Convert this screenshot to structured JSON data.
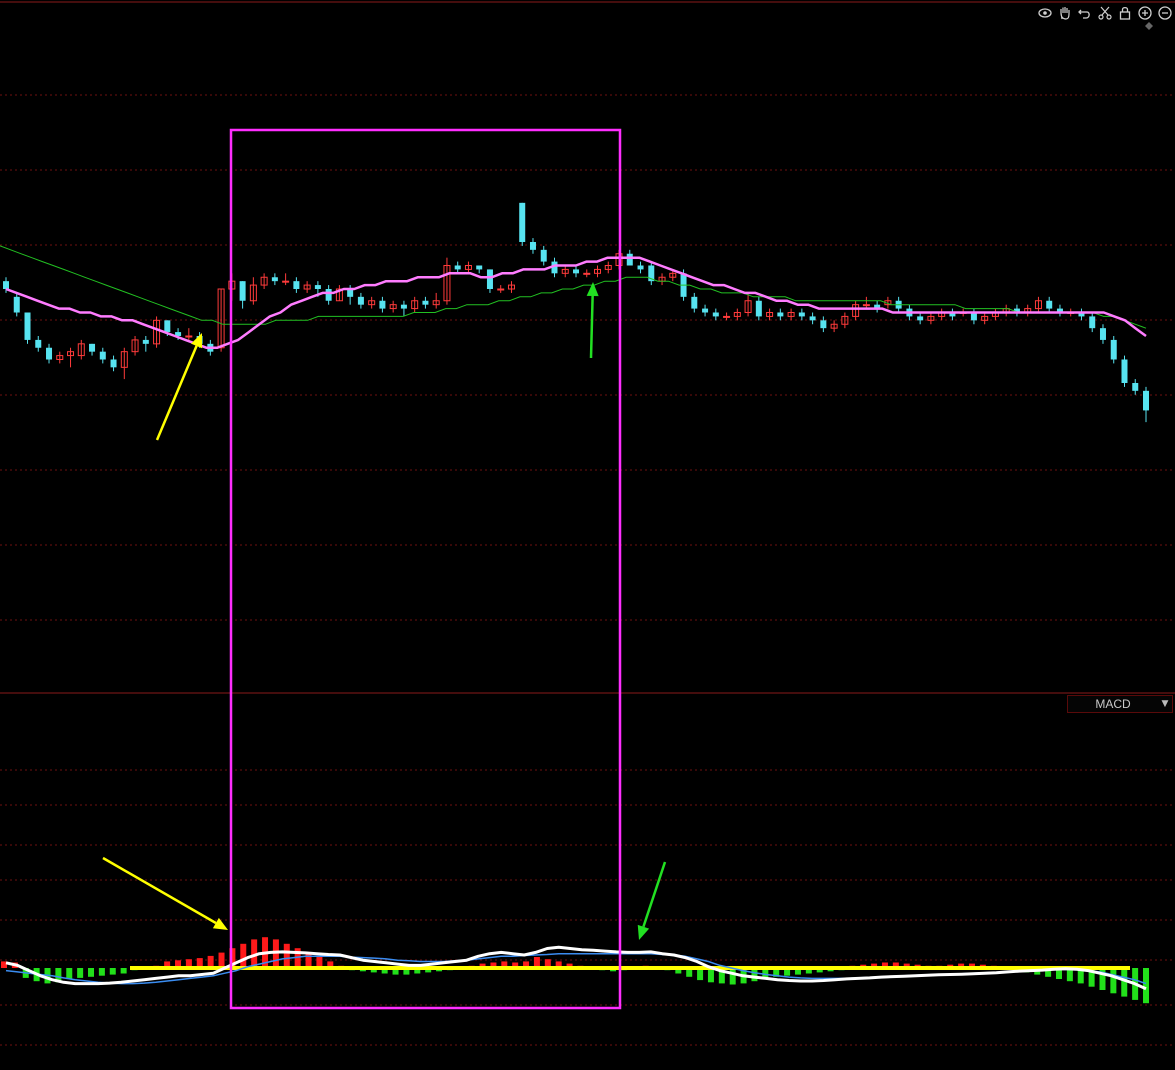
{
  "toolbar": {
    "tools": [
      {
        "name": "eye-icon",
        "title": ""
      },
      {
        "name": "hand-icon",
        "title": ""
      },
      {
        "name": "undo-icon",
        "title": ""
      },
      {
        "name": "scissors-icon",
        "title": ""
      },
      {
        "name": "lock-icon",
        "title": ""
      },
      {
        "name": "zoom-in-icon",
        "title": ""
      },
      {
        "name": "zoom-out-icon",
        "title": ""
      }
    ],
    "icon_color": "#cfcfcf"
  },
  "indicator": {
    "label": "MACD"
  },
  "colors": {
    "background": "#000000",
    "grid": "#6e0f0f",
    "divider": "#8a1a1a",
    "up_candle": "#ff3b3b",
    "down_candle": "#57e3f0",
    "ma_fast": "#ff7cff",
    "ma_slow": "#22c022",
    "macd_dif": "#ffffff",
    "macd_dea": "#3a8cf0",
    "macd_pos": "#ff1a1a",
    "macd_neg": "#22e01a",
    "zero_line": "#ffff00",
    "highlight_box": "#ff2eff",
    "arrow_yellow": "#ffff00",
    "arrow_green": "#22e022"
  },
  "chart_data": [
    {
      "type": "candlestick",
      "panel": "price",
      "count": 98,
      "candles": [
        [
          0.78,
          0.76,
          0.79,
          0.75
        ],
        [
          0.74,
          0.7,
          0.75,
          0.69
        ],
        [
          0.7,
          0.63,
          0.7,
          0.62
        ],
        [
          0.63,
          0.61,
          0.64,
          0.6
        ],
        [
          0.61,
          0.58,
          0.62,
          0.57
        ],
        [
          0.58,
          0.59,
          0.6,
          0.57
        ],
        [
          0.59,
          0.6,
          0.61,
          0.56
        ],
        [
          0.59,
          0.62,
          0.63,
          0.58
        ],
        [
          0.62,
          0.6,
          0.62,
          0.59
        ],
        [
          0.6,
          0.58,
          0.61,
          0.57
        ],
        [
          0.58,
          0.56,
          0.59,
          0.55
        ],
        [
          0.56,
          0.6,
          0.61,
          0.53
        ],
        [
          0.6,
          0.63,
          0.64,
          0.59
        ],
        [
          0.63,
          0.62,
          0.64,
          0.6
        ],
        [
          0.62,
          0.68,
          0.69,
          0.61
        ],
        [
          0.68,
          0.65,
          0.68,
          0.64
        ],
        [
          0.65,
          0.64,
          0.66,
          0.63
        ],
        [
          0.64,
          0.64,
          0.66,
          0.63
        ],
        [
          0.64,
          0.62,
          0.65,
          0.61
        ],
        [
          0.62,
          0.6,
          0.63,
          0.59
        ],
        [
          0.61,
          0.76,
          0.76,
          0.6
        ],
        [
          0.76,
          0.78,
          0.8,
          0.73
        ],
        [
          0.78,
          0.73,
          0.78,
          0.71
        ],
        [
          0.73,
          0.77,
          0.79,
          0.72
        ],
        [
          0.77,
          0.79,
          0.8,
          0.76
        ],
        [
          0.79,
          0.78,
          0.8,
          0.77
        ],
        [
          0.78,
          0.78,
          0.8,
          0.77
        ],
        [
          0.78,
          0.76,
          0.79,
          0.75
        ],
        [
          0.76,
          0.77,
          0.78,
          0.75
        ],
        [
          0.77,
          0.76,
          0.78,
          0.74
        ],
        [
          0.76,
          0.73,
          0.77,
          0.72
        ],
        [
          0.73,
          0.76,
          0.77,
          0.73
        ],
        [
          0.76,
          0.74,
          0.77,
          0.72
        ],
        [
          0.74,
          0.72,
          0.75,
          0.71
        ],
        [
          0.72,
          0.73,
          0.74,
          0.71
        ],
        [
          0.73,
          0.71,
          0.74,
          0.7
        ],
        [
          0.71,
          0.72,
          0.73,
          0.7
        ],
        [
          0.72,
          0.71,
          0.73,
          0.69
        ],
        [
          0.71,
          0.73,
          0.74,
          0.7
        ],
        [
          0.73,
          0.72,
          0.74,
          0.71
        ],
        [
          0.72,
          0.73,
          0.75,
          0.71
        ],
        [
          0.73,
          0.82,
          0.84,
          0.72
        ],
        [
          0.82,
          0.81,
          0.83,
          0.8
        ],
        [
          0.81,
          0.82,
          0.83,
          0.8
        ],
        [
          0.82,
          0.81,
          0.82,
          0.8
        ],
        [
          0.81,
          0.76,
          0.81,
          0.75
        ],
        [
          0.76,
          0.76,
          0.77,
          0.75
        ],
        [
          0.76,
          0.77,
          0.78,
          0.75
        ],
        [
          0.98,
          0.88,
          0.98,
          0.87
        ],
        [
          0.88,
          0.86,
          0.89,
          0.85
        ],
        [
          0.86,
          0.83,
          0.87,
          0.82
        ],
        [
          0.83,
          0.8,
          0.84,
          0.79
        ],
        [
          0.8,
          0.81,
          0.82,
          0.79
        ],
        [
          0.81,
          0.8,
          0.82,
          0.79
        ],
        [
          0.8,
          0.8,
          0.81,
          0.79
        ],
        [
          0.8,
          0.81,
          0.82,
          0.79
        ],
        [
          0.81,
          0.82,
          0.83,
          0.8
        ],
        [
          0.82,
          0.85,
          0.86,
          0.81
        ],
        [
          0.85,
          0.82,
          0.86,
          0.82
        ],
        [
          0.82,
          0.81,
          0.83,
          0.8
        ],
        [
          0.82,
          0.78,
          0.83,
          0.77
        ],
        [
          0.78,
          0.79,
          0.8,
          0.77
        ],
        [
          0.79,
          0.8,
          0.81,
          0.78
        ],
        [
          0.8,
          0.74,
          0.81,
          0.73
        ],
        [
          0.74,
          0.71,
          0.75,
          0.7
        ],
        [
          0.71,
          0.7,
          0.72,
          0.69
        ],
        [
          0.7,
          0.69,
          0.71,
          0.68
        ],
        [
          0.69,
          0.69,
          0.7,
          0.68
        ],
        [
          0.69,
          0.7,
          0.71,
          0.68
        ],
        [
          0.7,
          0.73,
          0.75,
          0.69
        ],
        [
          0.73,
          0.69,
          0.74,
          0.68
        ],
        [
          0.69,
          0.7,
          0.71,
          0.68
        ],
        [
          0.7,
          0.69,
          0.71,
          0.68
        ],
        [
          0.69,
          0.7,
          0.71,
          0.68
        ],
        [
          0.7,
          0.69,
          0.71,
          0.68
        ],
        [
          0.69,
          0.68,
          0.7,
          0.67
        ],
        [
          0.68,
          0.66,
          0.69,
          0.65
        ],
        [
          0.66,
          0.67,
          0.68,
          0.65
        ],
        [
          0.67,
          0.69,
          0.7,
          0.66
        ],
        [
          0.69,
          0.72,
          0.73,
          0.68
        ],
        [
          0.72,
          0.72,
          0.74,
          0.71
        ],
        [
          0.72,
          0.71,
          0.73,
          0.7
        ],
        [
          0.72,
          0.73,
          0.74,
          0.71
        ],
        [
          0.73,
          0.71,
          0.74,
          0.7
        ],
        [
          0.71,
          0.69,
          0.72,
          0.68
        ],
        [
          0.69,
          0.68,
          0.7,
          0.67
        ],
        [
          0.68,
          0.69,
          0.7,
          0.67
        ],
        [
          0.69,
          0.7,
          0.71,
          0.68
        ],
        [
          0.7,
          0.69,
          0.71,
          0.68
        ],
        [
          0.7,
          0.7,
          0.71,
          0.69
        ],
        [
          0.7,
          0.68,
          0.71,
          0.67
        ],
        [
          0.68,
          0.69,
          0.7,
          0.67
        ],
        [
          0.69,
          0.7,
          0.71,
          0.68
        ],
        [
          0.7,
          0.71,
          0.72,
          0.69
        ],
        [
          0.71,
          0.7,
          0.72,
          0.69
        ],
        [
          0.7,
          0.71,
          0.72,
          0.69
        ],
        [
          0.71,
          0.73,
          0.74,
          0.7
        ],
        [
          0.73,
          0.71,
          0.74,
          0.7
        ]
      ],
      "tail_candles": [
        [
          0.71,
          0.7,
          0.72,
          0.69
        ],
        [
          0.7,
          0.7,
          0.71,
          0.69
        ],
        [
          0.7,
          0.69,
          0.71,
          0.68
        ],
        [
          0.69,
          0.66,
          0.7,
          0.65
        ],
        [
          0.66,
          0.63,
          0.67,
          0.62
        ],
        [
          0.63,
          0.58,
          0.64,
          0.57
        ],
        [
          0.58,
          0.52,
          0.59,
          0.51
        ],
        [
          0.52,
          0.5,
          0.53,
          0.49
        ],
        [
          0.5,
          0.45,
          0.51,
          0.42
        ]
      ],
      "ma_fast": [
        0.76,
        0.75,
        0.74,
        0.73,
        0.72,
        0.71,
        0.71,
        0.7,
        0.7,
        0.69,
        0.69,
        0.68,
        0.68,
        0.67,
        0.66,
        0.65,
        0.64,
        0.63,
        0.62,
        0.61,
        0.61,
        0.62,
        0.63,
        0.65,
        0.67,
        0.69,
        0.7,
        0.72,
        0.73,
        0.74,
        0.75,
        0.75,
        0.76,
        0.76,
        0.77,
        0.77,
        0.78,
        0.78,
        0.78,
        0.79,
        0.79,
        0.79,
        0.8,
        0.8,
        0.8,
        0.79,
        0.79,
        0.8,
        0.8,
        0.81,
        0.81,
        0.81,
        0.82,
        0.82,
        0.82,
        0.83,
        0.83,
        0.84,
        0.84,
        0.84,
        0.84,
        0.83,
        0.82,
        0.81,
        0.8,
        0.79,
        0.78,
        0.77,
        0.77,
        0.76,
        0.75,
        0.75,
        0.74,
        0.73,
        0.73,
        0.72,
        0.72,
        0.71,
        0.71,
        0.71,
        0.71,
        0.71,
        0.71,
        0.71,
        0.7,
        0.7,
        0.7,
        0.7,
        0.7,
        0.7,
        0.7,
        0.7,
        0.7,
        0.7,
        0.7,
        0.7,
        0.7,
        0.7,
        0.7,
        0.7,
        0.7,
        0.7,
        0.7,
        0.7,
        0.7,
        0.69,
        0.68,
        0.66,
        0.64
      ],
      "ma_slow": [
        0.87,
        0.86,
        0.85,
        0.84,
        0.83,
        0.82,
        0.81,
        0.8,
        0.79,
        0.78,
        0.77,
        0.76,
        0.75,
        0.74,
        0.73,
        0.72,
        0.71,
        0.7,
        0.69,
        0.68,
        0.68,
        0.67,
        0.67,
        0.67,
        0.67,
        0.67,
        0.68,
        0.68,
        0.68,
        0.68,
        0.69,
        0.69,
        0.69,
        0.69,
        0.69,
        0.69,
        0.69,
        0.69,
        0.69,
        0.7,
        0.7,
        0.7,
        0.71,
        0.71,
        0.72,
        0.72,
        0.72,
        0.73,
        0.73,
        0.74,
        0.74,
        0.75,
        0.75,
        0.76,
        0.76,
        0.77,
        0.77,
        0.78,
        0.78,
        0.79,
        0.79,
        0.79,
        0.78,
        0.78,
        0.77,
        0.77,
        0.76,
        0.76,
        0.75,
        0.75,
        0.75,
        0.74,
        0.74,
        0.74,
        0.74,
        0.73,
        0.73,
        0.73,
        0.73,
        0.73,
        0.73,
        0.73,
        0.73,
        0.73,
        0.72,
        0.72,
        0.72,
        0.72,
        0.72,
        0.72,
        0.72,
        0.71,
        0.71,
        0.71,
        0.71,
        0.71,
        0.7,
        0.7,
        0.7,
        0.7,
        0.7,
        0.7,
        0.7,
        0.7,
        0.69,
        0.69,
        0.68,
        0.67,
        0.66
      ],
      "grid": true,
      "title": "",
      "xlabel": "",
      "ylabel": ""
    },
    {
      "type": "bar",
      "panel": "macd",
      "indicator": "MACD",
      "hist": [
        0.3,
        0.25,
        -0.45,
        -0.6,
        -0.7,
        -0.65,
        -0.5,
        -0.45,
        -0.4,
        -0.35,
        -0.3,
        -0.25,
        -0.1,
        0.0,
        0.1,
        0.3,
        0.35,
        0.4,
        0.45,
        0.55,
        0.7,
        0.9,
        1.1,
        1.3,
        1.4,
        1.3,
        1.1,
        0.9,
        0.7,
        0.5,
        0.3,
        0.1,
        -0.1,
        -0.15,
        -0.2,
        -0.25,
        -0.3,
        -0.3,
        -0.25,
        -0.2,
        -0.15,
        -0.1,
        0.05,
        0.1,
        0.2,
        0.25,
        0.3,
        0.25,
        0.3,
        0.5,
        0.4,
        0.3,
        0.2,
        0.1,
        -0.05,
        -0.1,
        -0.15,
        -0.1,
        0.05,
        0.1,
        0.05,
        -0.1,
        -0.25,
        -0.4,
        -0.55,
        -0.65,
        -0.7,
        -0.75,
        -0.7,
        -0.6,
        -0.5,
        -0.4,
        -0.35,
        -0.3,
        -0.25,
        -0.2,
        -0.15,
        -0.1,
        0.1,
        0.15,
        0.2,
        0.25,
        0.25,
        0.2,
        0.15,
        0.1,
        0.1,
        0.15,
        0.2,
        0.2,
        0.15,
        0.1,
        0.05,
        -0.1,
        -0.2,
        -0.3,
        -0.4,
        -0.5,
        -0.6,
        -0.7,
        -0.85,
        -1.0,
        -1.15,
        -1.3,
        -1.45,
        -1.6
      ],
      "dif": [
        0.2,
        0.1,
        -0.1,
        -0.3,
        -0.45,
        -0.55,
        -0.6,
        -0.6,
        -0.6,
        -0.58,
        -0.55,
        -0.5,
        -0.45,
        -0.4,
        -0.35,
        -0.3,
        -0.3,
        -0.25,
        -0.2,
        0.0,
        0.2,
        0.4,
        0.55,
        0.6,
        0.62,
        0.6,
        0.58,
        0.55,
        0.52,
        0.5,
        0.4,
        0.3,
        0.25,
        0.2,
        0.15,
        0.1,
        0.1,
        0.15,
        0.2,
        0.25,
        0.3,
        0.45,
        0.55,
        0.6,
        0.55,
        0.5,
        0.6,
        0.75,
        0.8,
        0.75,
        0.7,
        0.68,
        0.65,
        0.62,
        0.6,
        0.6,
        0.62,
        0.55,
        0.5,
        0.4,
        0.25,
        0.05,
        -0.1,
        -0.2,
        -0.3,
        -0.35,
        -0.4,
        -0.45,
        -0.48,
        -0.5,
        -0.5,
        -0.48,
        -0.45,
        -0.42,
        -0.4,
        -0.38,
        -0.35,
        -0.33,
        -0.32,
        -0.3,
        -0.28,
        -0.26,
        -0.25,
        -0.24,
        -0.22,
        -0.2,
        -0.18,
        -0.15,
        -0.12,
        -0.1,
        -0.08,
        -0.05,
        -0.03,
        -0.05,
        -0.1,
        -0.2,
        -0.3,
        -0.45,
        -0.6,
        -0.8
      ],
      "dea": [
        -0.1,
        -0.15,
        -0.2,
        -0.25,
        -0.3,
        -0.38,
        -0.45,
        -0.5,
        -0.55,
        -0.58,
        -0.6,
        -0.6,
        -0.58,
        -0.55,
        -0.5,
        -0.45,
        -0.4,
        -0.35,
        -0.3,
        -0.2,
        -0.1,
        0.05,
        0.15,
        0.25,
        0.35,
        0.4,
        0.45,
        0.45,
        0.45,
        0.45,
        0.42,
        0.4,
        0.38,
        0.35,
        0.3,
        0.28,
        0.25,
        0.25,
        0.25,
        0.28,
        0.3,
        0.35,
        0.4,
        0.45,
        0.45,
        0.48,
        0.5,
        0.52,
        0.55,
        0.55,
        0.55,
        0.55,
        0.55,
        0.55,
        0.55,
        0.55,
        0.55,
        0.52,
        0.5,
        0.45,
        0.35,
        0.25,
        0.1,
        0.0,
        -0.1,
        -0.18,
        -0.25,
        -0.3,
        -0.35,
        -0.38,
        -0.4,
        -0.4,
        -0.4,
        -0.4,
        -0.38,
        -0.36,
        -0.34,
        -0.32,
        -0.3,
        -0.28,
        -0.26,
        -0.25,
        -0.24,
        -0.22,
        -0.2,
        -0.18,
        -0.16,
        -0.14,
        -0.12,
        -0.1,
        -0.08,
        -0.06,
        -0.05,
        -0.06,
        -0.1,
        -0.15,
        -0.25,
        -0.35,
        -0.45,
        -0.6
      ],
      "grid": true,
      "title": "",
      "xlabel": "",
      "ylabel": ""
    }
  ]
}
